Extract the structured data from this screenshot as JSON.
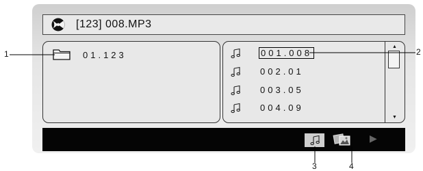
{
  "header": {
    "title": "[123] 008.MP3",
    "icon": "disc-icon"
  },
  "folder_panel": {
    "items": [
      {
        "icon": "folder-icon",
        "label": "01.123"
      }
    ]
  },
  "file_panel": {
    "items": [
      {
        "icon": "music-note-icon",
        "label": "001.008",
        "selected": true
      },
      {
        "icon": "music-note-icon",
        "label": "002.01"
      },
      {
        "icon": "music-note-icon",
        "label": "003.05"
      },
      {
        "icon": "music-note-icon",
        "label": "004.09"
      }
    ],
    "scrollbar": {
      "up": "▲",
      "down": "▼"
    }
  },
  "toolbar": {
    "buttons": [
      {
        "name": "music-filter",
        "icon": "music-note-icon",
        "active": true
      },
      {
        "name": "photo-filter",
        "icon": "photo-icon"
      },
      {
        "name": "next",
        "icon": "play-icon",
        "glyph": "▶"
      }
    ]
  },
  "callouts": [
    "1",
    "2",
    "3",
    "4"
  ]
}
